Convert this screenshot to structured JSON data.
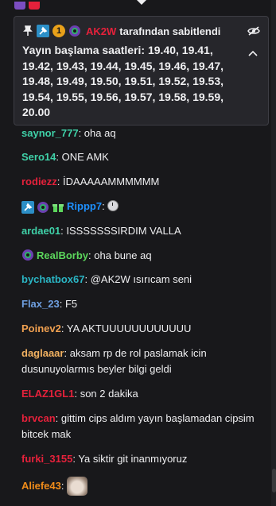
{
  "colors": {
    "background": "#18181b",
    "pinned_bg": "#26262b",
    "text": "#efeff1"
  },
  "pinned": {
    "icons": [
      "pin-icon",
      "moderator-badge-icon",
      "gold-badge-icon",
      "subscriber-badge-icon"
    ],
    "badge_gold_text": "1",
    "username": "AK2W",
    "username_color": "#e5213b",
    "by_text": "tarafından sabitlendi",
    "message": "Yayın başlama saatleri: 19.40, 19.41, 19.42, 19.43, 19.44, 19.45, 19.46, 19.47, 19.48, 19.49, 19.50, 19.51, 19.52, 19.53, 19.54, 19.55, 19.56, 19.57, 19.58, 19.59, 20.00",
    "hide_icon": "eye-slash-icon",
    "collapse_icon": "chevron-up-icon"
  },
  "messages": [
    {
      "user": "saynor_777",
      "color": "#3fd1a8",
      "sep": ": ",
      "text": "oha aq"
    },
    {
      "user": "Sero14",
      "color": "#3fd1a8",
      "sep": ": ",
      "text": "ONE AMK"
    },
    {
      "user": "rodiezz",
      "color": "#e5213b",
      "sep": ": ",
      "text": "İDAAAAAMMMMMM"
    },
    {
      "user": "Rippp7",
      "color": "#1e90ff",
      "sep": ": ",
      "text": "",
      "badges": [
        "moderator-badge-icon",
        "subscriber-badge-icon",
        "gift-badge-icon"
      ],
      "emoji": "clock-emoji-icon"
    },
    {
      "user": "ardae01",
      "color": "#3fd1a8",
      "sep": ": ",
      "text": "ISSSSSSSIRDIM VALLA"
    },
    {
      "user": "RealBorby",
      "color": "#5cd65c",
      "sep": ": ",
      "text": "oha bune aq",
      "badges": [
        "subscriber-badge-icon"
      ]
    },
    {
      "user": "bychatbox67",
      "color": "#2ab5c4",
      "sep": ": ",
      "text": "@AK2W ısırıcam seni"
    },
    {
      "user": "Flax_23",
      "color": "#6f9fe0",
      "sep": ": ",
      "text": "F5"
    },
    {
      "user": "Poinev2",
      "color": "#f0a050",
      "sep": ": ",
      "text": "YA AKTUUUUUUUUUUUU"
    },
    {
      "user": "daglaaar",
      "color": "#f0b060",
      "sep": ": ",
      "text": "aksam rp de rol paslamak icin dusunuyolarmıs beyler bilgi geldi"
    },
    {
      "user": "ELAZ1GL1",
      "color": "#e5213b",
      "sep": ": ",
      "text": "son 2 dakika"
    },
    {
      "user": "brvcan",
      "color": "#e5213b",
      "sep": ": ",
      "text": "gittim cips aldım yayın başlamadan cipsim bitcek mak"
    },
    {
      "user": "furki_3155",
      "color": "#e5213b",
      "sep": ": ",
      "text": "Ya siktir git inanmıyoruz"
    },
    {
      "user": "Aliefe43",
      "color": "#f08c1a",
      "sep": ": ",
      "text": "",
      "emote": "animal-emote"
    }
  ]
}
